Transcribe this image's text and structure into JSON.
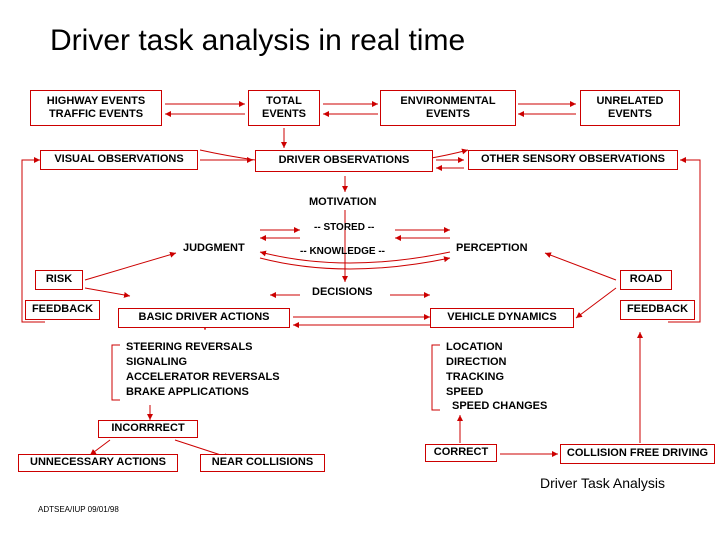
{
  "title": "Driver task analysis in real time",
  "boxes": {
    "highway_events": "HIGHWAY EVENTS",
    "traffic_events": "TRAFFIC EVENTS",
    "total": "TOTAL",
    "events": "EVENTS",
    "environmental": "ENVIRONMENTAL",
    "unrelated": "UNRELATED",
    "visual_obs": "VISUAL OBSERVATIONS",
    "driver_obs": "DRIVER OBSERVATIONS",
    "other_sensory": "OTHER SENSORY OBSERVATIONS"
  },
  "center": {
    "motivation": "MOTIVATION",
    "stored": "-- STORED --",
    "knowledge": "-- KNOWLEDGE --",
    "decisions": "DECISIONS",
    "judgment": "JUDGMENT",
    "perception": "PERCEPTION"
  },
  "side": {
    "risk": "RISK",
    "road": "ROAD",
    "feedback": "FEEDBACK"
  },
  "actions": {
    "basic": "BASIC DRIVER ACTIONS",
    "vehicle": "VEHICLE DYNAMICS",
    "left_list": [
      "STEERING REVERSALS",
      "SIGNALING",
      "ACCELERATOR REVERSALS",
      "BRAKE APPLICATIONS"
    ],
    "right_list": [
      "LOCATION",
      "DIRECTION",
      "TRACKING",
      "SPEED",
      "SPEED CHANGES"
    ]
  },
  "bottom": {
    "incorrect": "INCORRRECT",
    "unnecessary": "UNNECESSARY ACTIONS",
    "near": "NEAR COLLISIONS",
    "correct": "CORRECT",
    "collision_free": "COLLISION FREE DRIVING"
  },
  "caption": "Driver Task Analysis",
  "footer": "ADTSEA/IUP 09/01/98"
}
